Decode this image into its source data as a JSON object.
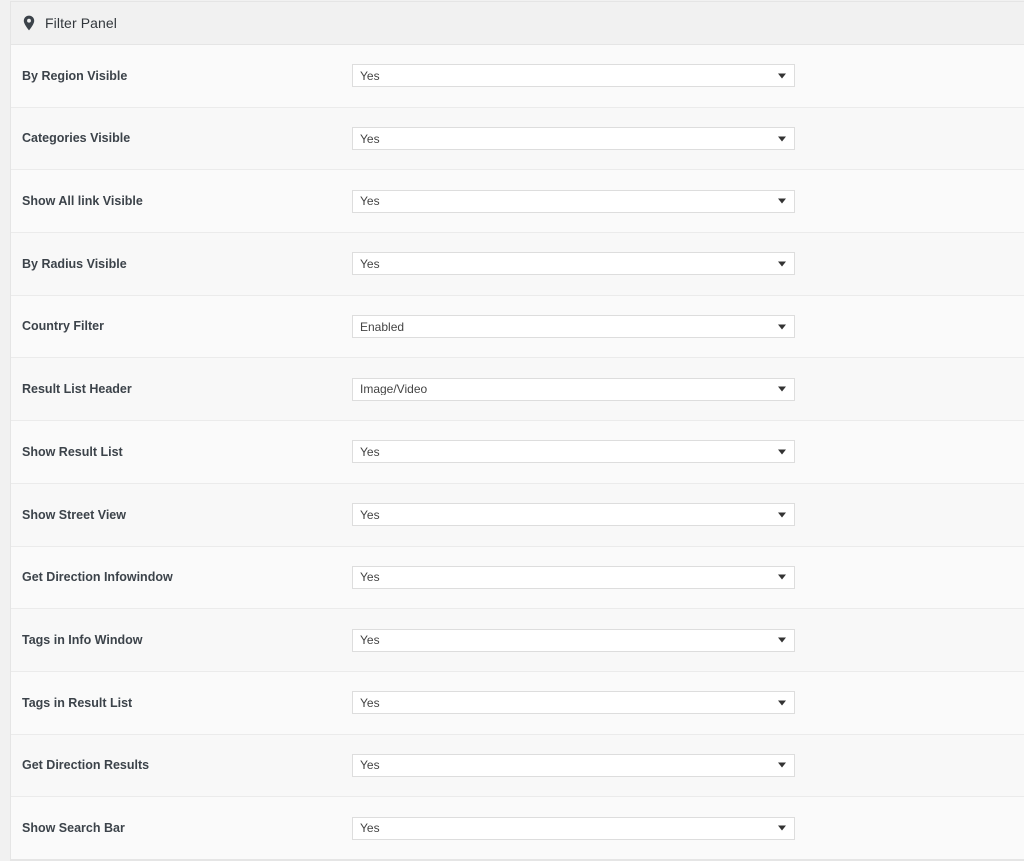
{
  "panel": {
    "icon": "map-pin-icon",
    "title": "Filter Panel"
  },
  "settings": [
    {
      "label": "By Region Visible",
      "value": "Yes"
    },
    {
      "label": "Categories Visible",
      "value": "Yes"
    },
    {
      "label": "Show All link Visible",
      "value": "Yes"
    },
    {
      "label": "By Radius Visible",
      "value": "Yes"
    },
    {
      "label": "Country Filter",
      "value": "Enabled"
    },
    {
      "label": "Result List Header",
      "value": "Image/Video"
    },
    {
      "label": "Show Result List",
      "value": "Yes"
    },
    {
      "label": "Show Street View",
      "value": "Yes"
    },
    {
      "label": "Get Direction Infowindow",
      "value": "Yes"
    },
    {
      "label": "Tags in Info Window",
      "value": "Yes"
    },
    {
      "label": "Tags in Result List",
      "value": "Yes"
    },
    {
      "label": "Get Direction Results",
      "value": "Yes"
    },
    {
      "label": "Show Search Bar",
      "value": "Yes"
    }
  ],
  "colors": {
    "page_background": "#f1f1f1",
    "panel_background": "#fafafa",
    "panel_border": "#e5e5e5",
    "header_background": "#f1f1f1",
    "label_text": "#3c434a",
    "select_border": "#dddddd",
    "select_text": "#444444"
  }
}
